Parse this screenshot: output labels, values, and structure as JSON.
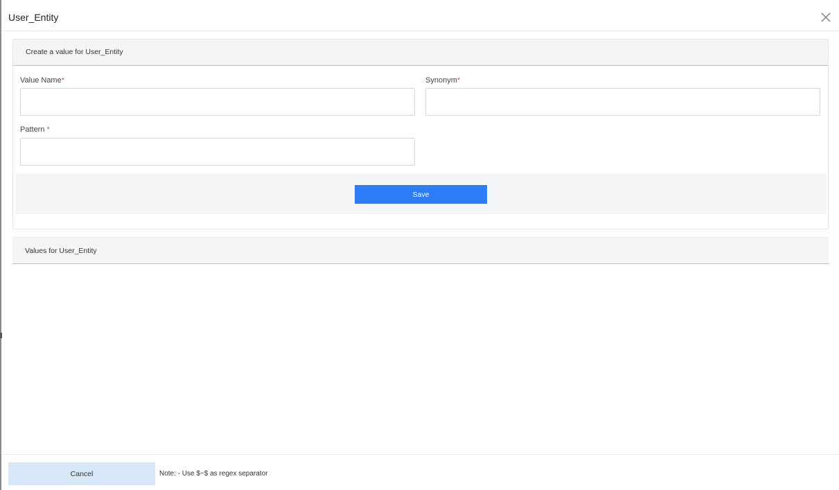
{
  "dialog": {
    "title": "User_Entity"
  },
  "create_panel": {
    "heading": "Create a value for User_Entity",
    "fields": {
      "value_name": {
        "label": "Value Name",
        "required_mark": "*",
        "value": ""
      },
      "synonym": {
        "label": "Synonym",
        "required_mark": "*",
        "value": ""
      },
      "pattern": {
        "label": "Pattern ",
        "required_mark": "*",
        "value": ""
      }
    },
    "save_label": "Save"
  },
  "values_panel": {
    "heading": "Values for User_Entity"
  },
  "footer": {
    "cancel_label": "Cancel",
    "note": "Note: - Use $~$ as regex separator"
  },
  "colors": {
    "primary": "#2b7cf6",
    "cancel_bg": "#d6e8f8",
    "required": "#d9534f"
  },
  "icons": {
    "close": "close-icon"
  }
}
